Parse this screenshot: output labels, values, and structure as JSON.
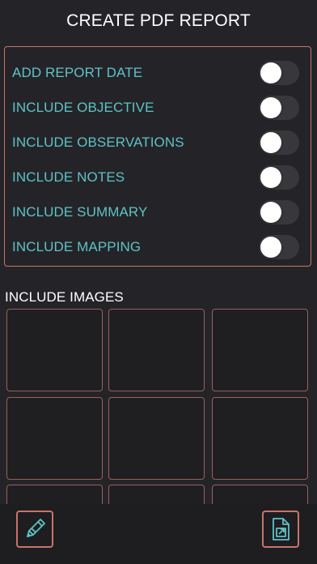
{
  "header": {
    "title": "CREATE PDF REPORT"
  },
  "options": [
    {
      "label": "ADD REPORT DATE",
      "enabled": false
    },
    {
      "label": "INCLUDE OBJECTIVE",
      "enabled": false
    },
    {
      "label": "INCLUDE OBSERVATIONS",
      "enabled": false
    },
    {
      "label": "INCLUDE NOTES",
      "enabled": false
    },
    {
      "label": "INCLUDE SUMMARY",
      "enabled": false
    },
    {
      "label": "INCLUDE MAPPING",
      "enabled": false
    }
  ],
  "images_section": {
    "label": "INCLUDE IMAGES"
  },
  "toolbar": {
    "left_icon": "pencil-icon",
    "right_icon": "export-document-icon"
  },
  "colors": {
    "background": "#242428",
    "accent": "#c9736a",
    "option_text": "#5fc2c6"
  }
}
